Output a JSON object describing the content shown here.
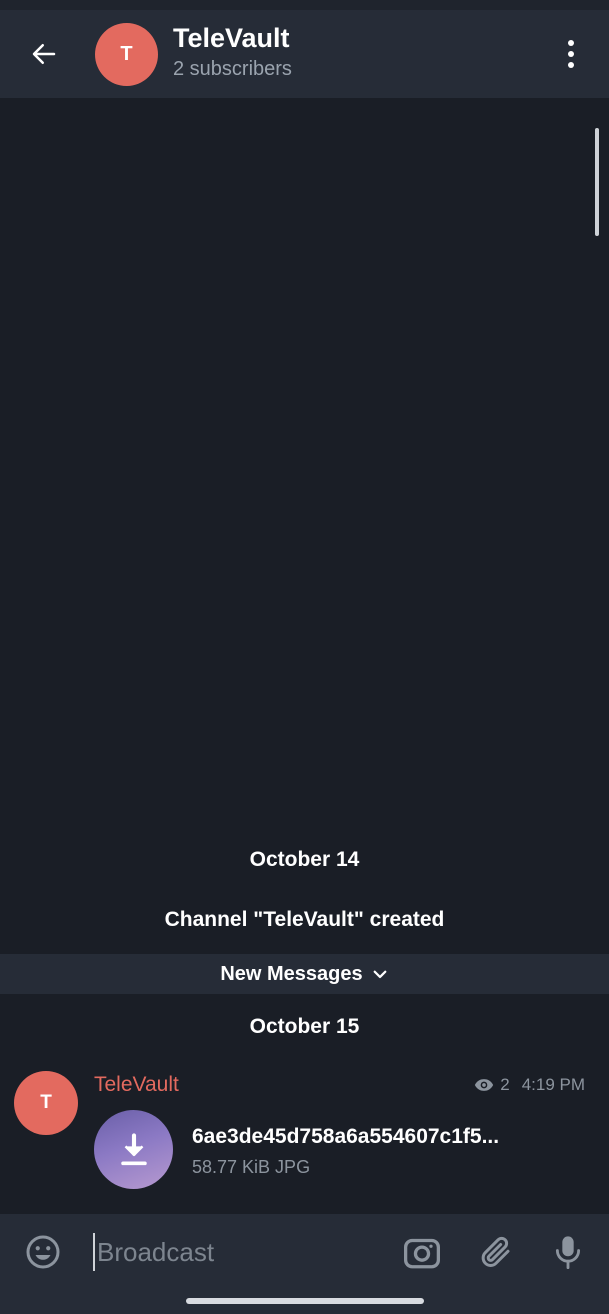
{
  "header": {
    "avatar_letter": "T",
    "title": "TeleVault",
    "subtitle": "2 subscribers",
    "icons": {
      "back": "arrow-left-icon",
      "menu": "more-vertical-icon"
    }
  },
  "chat": {
    "date_1": "October 14",
    "service_message": "Channel \"TeleVault\" created",
    "new_messages_label": "New Messages",
    "date_2": "October 15",
    "message": {
      "avatar_letter": "T",
      "sender": "TeleVault",
      "views": "2",
      "time": "4:19 PM",
      "file_name": "6ae3de45d758a6a554607c1f5...",
      "file_size": "58.77 KiB JPG"
    }
  },
  "composer": {
    "placeholder": "Broadcast",
    "icons": [
      "emoji-icon",
      "camera-icon",
      "attach-icon",
      "microphone-icon"
    ]
  },
  "colors": {
    "background": "#1a1e26",
    "header": "#262c37",
    "accent": "#e36a5f",
    "secondary_text": "#8c949e"
  }
}
